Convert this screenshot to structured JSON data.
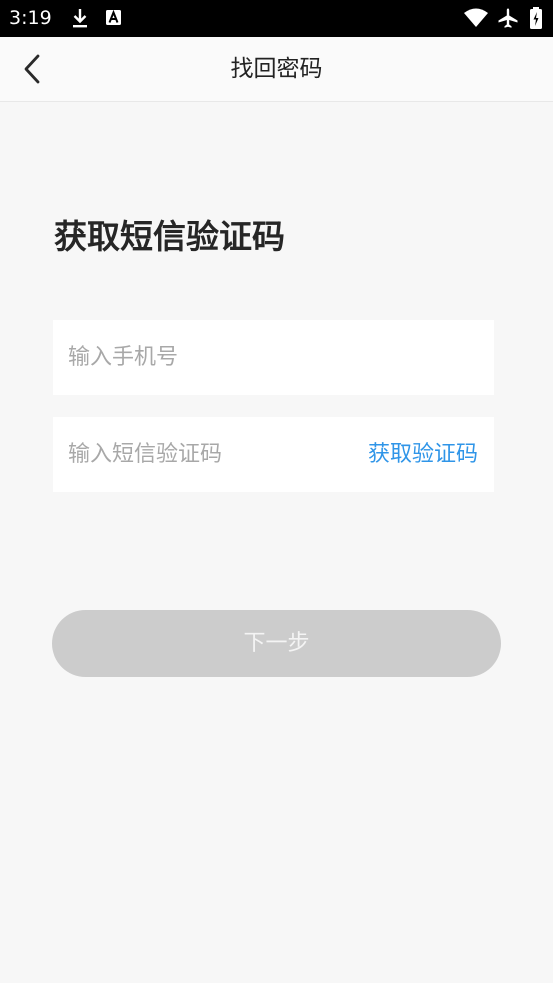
{
  "status_bar": {
    "time": "3:19",
    "icons": [
      "download-icon",
      "a-notification-icon",
      "wifi-icon",
      "airplane-mode-icon",
      "battery-icon"
    ]
  },
  "nav": {
    "title": "找回密码",
    "back_icon": "chevron-left-icon"
  },
  "form": {
    "heading": "获取短信验证码",
    "phone_placeholder": "输入手机号",
    "code_placeholder": "输入短信验证码",
    "get_code_label": "获取验证码",
    "next_label": "下一步"
  },
  "colors": {
    "accent": "#2f95e8",
    "disabled_button": "#cccccc",
    "background": "#f7f7f7"
  }
}
